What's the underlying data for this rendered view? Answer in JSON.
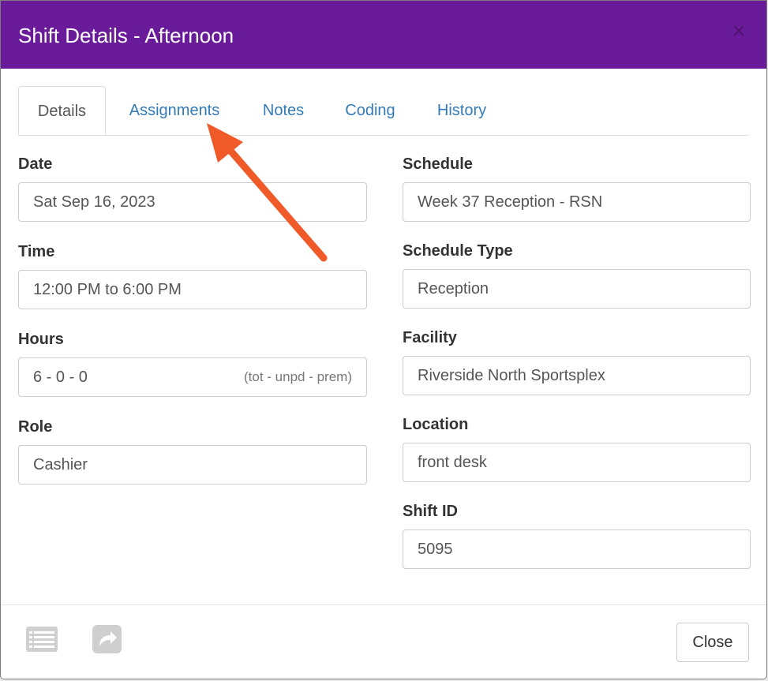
{
  "dialog": {
    "title": "Shift Details - Afternoon",
    "close_glyph": "×"
  },
  "tabs": [
    {
      "label": "Details",
      "active": true
    },
    {
      "label": "Assignments",
      "active": false
    },
    {
      "label": "Notes",
      "active": false
    },
    {
      "label": "Coding",
      "active": false
    },
    {
      "label": "History",
      "active": false
    }
  ],
  "left_fields": {
    "date": {
      "label": "Date",
      "value": "Sat Sep 16, 2023"
    },
    "time": {
      "label": "Time",
      "value": "12:00 PM to 6:00 PM"
    },
    "hours": {
      "label": "Hours",
      "value": "6 - 0 - 0",
      "hint": "(tot - unpd - prem)"
    },
    "role": {
      "label": "Role",
      "value": "Cashier"
    }
  },
  "right_fields": {
    "schedule": {
      "label": "Schedule",
      "value": "Week 37 Reception - RSN"
    },
    "schedule_type": {
      "label": "Schedule Type",
      "value": "Reception"
    },
    "facility": {
      "label": "Facility",
      "value": "Riverside North Sportsplex"
    },
    "location": {
      "label": "Location",
      "value": "front desk"
    },
    "shift_id": {
      "label": "Shift ID",
      "value": "5095"
    }
  },
  "footer": {
    "close_label": "Close",
    "icons": [
      "list-icon",
      "share-icon"
    ]
  },
  "colors": {
    "header_bg": "#6a1b9a",
    "tab_link": "#337ab7",
    "annotation_arrow": "#f05a28"
  }
}
